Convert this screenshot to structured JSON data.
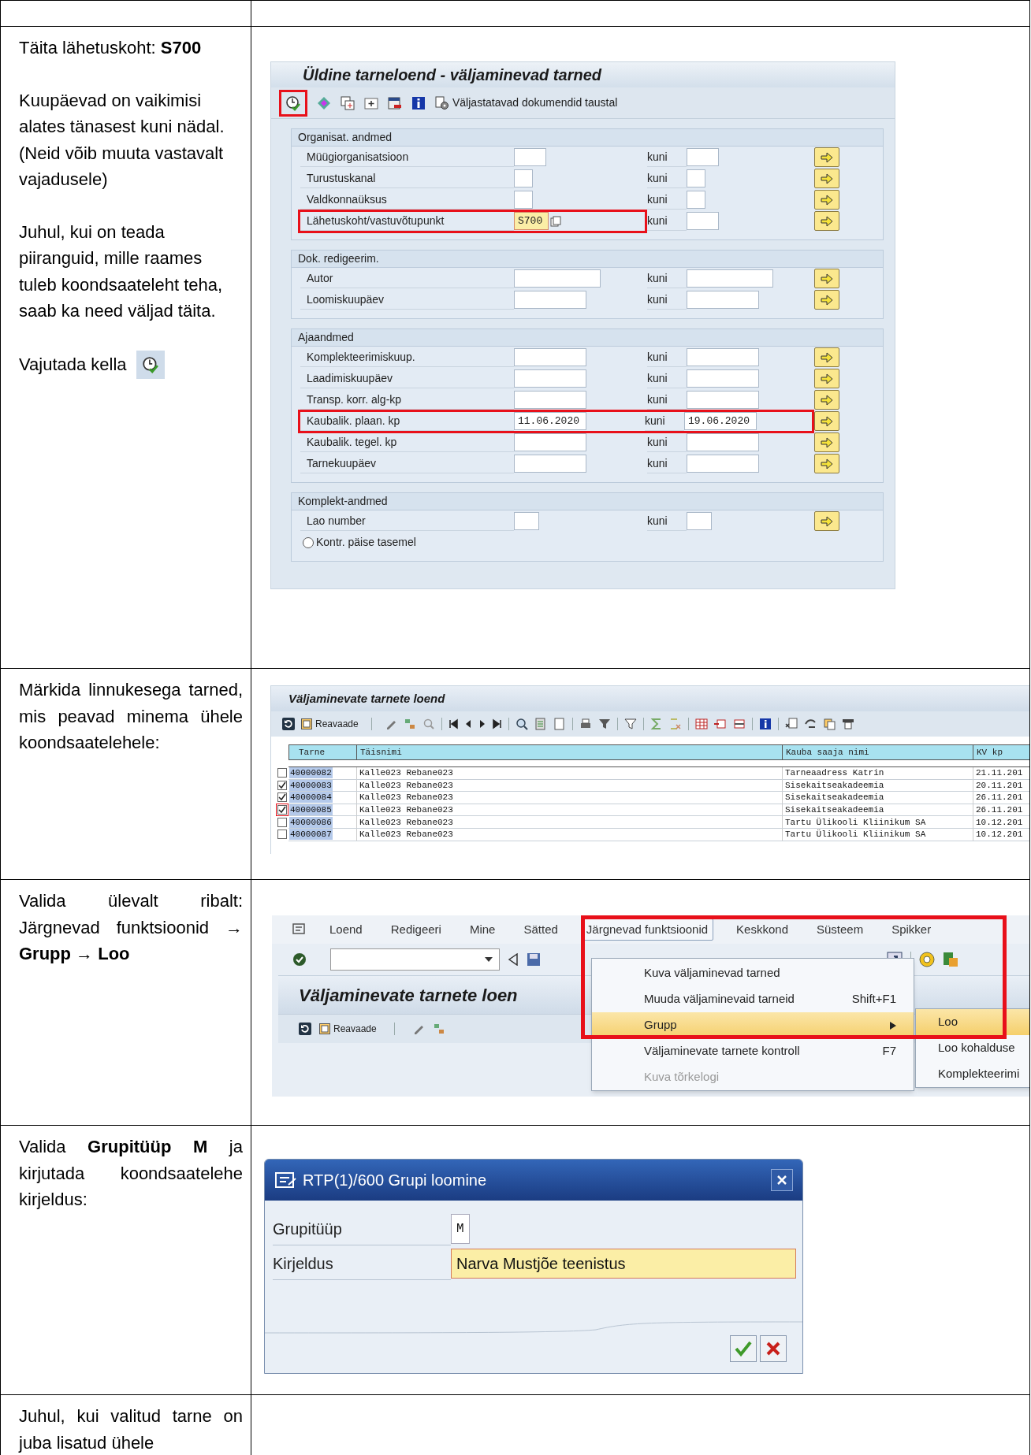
{
  "steps": [
    {
      "kind": "selection_screen",
      "paragraphs": [
        "Täita lähetuskoht: **S700**",
        "Kuupäevad on vaikimisi alates tänasest kuni nädal. (Neid võib muuta vastavalt vajadusele)",
        "Juhul, kui on teada piiranguid, mille raames tuleb koondsaateleht teha, saab ka need väljad täita.",
        "Vajutada kella"
      ],
      "screen": {
        "title": "Üldine tarneloend - väljaminevad tarned",
        "execute_highlighted": true,
        "toolbar_button": "Väljastatavad dokumendid taustal",
        "sections": [
          {
            "title": "Organisat. andmed",
            "rows": [
              {
                "label": "Müügiorganisatsioon",
                "to_label": "kuni",
                "highlighted": false,
                "focused": false
              },
              {
                "label": "Turustuskanal",
                "to_label": "kuni",
                "highlighted": false,
                "focused": false
              },
              {
                "label": "Valdkonnaüksus",
                "to_label": "kuni",
                "highlighted": false,
                "focused": false
              },
              {
                "label": "Lähetuskoht/vastuvõtupunkt",
                "from": "S700",
                "to_label": "kuni",
                "highlighted": true,
                "focused": true
              }
            ]
          },
          {
            "title": "Dok. redigeerim.",
            "rows": [
              {
                "label": "Autor",
                "to_label": "kuni",
                "highlighted": false,
                "focused": false
              },
              {
                "label": "Loomiskuupäev",
                "to_label": "kuni",
                "highlighted": false,
                "focused": false
              }
            ]
          },
          {
            "title": "Ajaandmed",
            "rows": [
              {
                "label": "Komplekteerimiskuup.",
                "to_label": "kuni",
                "highlighted": false,
                "focused": false
              },
              {
                "label": "Laadimiskuupäev",
                "to_label": "kuni",
                "highlighted": false,
                "focused": false
              },
              {
                "label": "Transp. korr. alg-kp",
                "to_label": "kuni",
                "highlighted": false,
                "focused": false
              },
              {
                "label": "Kaubalik. plaan. kp",
                "from": "11.06.2020",
                "to_label": "kuni",
                "to": "19.06.2020",
                "highlighted": true,
                "focused": false
              },
              {
                "label": "Kaubalik. tegel. kp",
                "to_label": "kuni",
                "highlighted": false,
                "focused": false
              },
              {
                "label": "Tarnekuupäev",
                "to_label": "kuni",
                "highlighted": false,
                "focused": false
              }
            ]
          },
          {
            "title": "Komplekt-andmed",
            "rows": [
              {
                "label": "Lao number",
                "to_label": "kuni",
                "highlighted": false,
                "focused": false
              }
            ],
            "options": [
              {
                "label": "Kontr. päise tasemel",
                "selected": false
              }
            ]
          }
        ]
      }
    },
    {
      "kind": "delivery_list",
      "paragraphs": [
        "Märkida linnukesega tarned, mis peavad minema ühele koondsaatelehele:"
      ],
      "screen": {
        "title": "Väljaminevate tarnete loend",
        "toolbar_button": "Reavaade",
        "columns": [
          "Tarne",
          "Täisnimi",
          "Kauba saaja nimi",
          "KV kp"
        ],
        "rows": [
          {
            "checked": false,
            "focused": false,
            "cells": [
              "40000082",
              "Kalle023 Rebane023",
              "Tarneaadress Katrin",
              "21.11.201"
            ]
          },
          {
            "checked": true,
            "focused": false,
            "cells": [
              "40000083",
              "Kalle023 Rebane023",
              "Sisekaitseakadeemia",
              "20.11.201"
            ]
          },
          {
            "checked": true,
            "focused": false,
            "cells": [
              "40000084",
              "Kalle023 Rebane023",
              "Sisekaitseakadeemia",
              "26.11.201"
            ]
          },
          {
            "checked": true,
            "focused": true,
            "cells": [
              "40000085",
              "Kalle023 Rebane023",
              "Sisekaitseakadeemia",
              "26.11.201"
            ]
          },
          {
            "checked": false,
            "focused": false,
            "cells": [
              "40000086",
              "Kalle023 Rebane023",
              "Tartu Ülikooli Kliinikum SA",
              "10.12.201"
            ]
          },
          {
            "checked": false,
            "focused": false,
            "cells": [
              "40000087",
              "Kalle023 Rebane023",
              "Tartu Ülikooli Kliinikum SA",
              "10.12.201"
            ]
          }
        ]
      }
    },
    {
      "kind": "menu",
      "paragraphs": [
        "Valida ülevalt ribalt: Järgnevad funktsioonid → **Grupp** → **Loo**"
      ],
      "screen": {
        "menu": [
          {
            "label": "Loend",
            "selected": false
          },
          {
            "label": "Redigeeri",
            "selected": false
          },
          {
            "label": "Mine",
            "selected": false
          },
          {
            "label": "Sätted",
            "selected": false
          },
          {
            "label": "Järgnevad funktsioonid",
            "selected": true
          },
          {
            "label": "Keskkond",
            "selected": false
          },
          {
            "label": "Süsteem",
            "selected": false
          },
          {
            "label": "Spikker",
            "selected": false
          }
        ],
        "dropdown": [
          {
            "label": "Kuva väljaminevad tarned",
            "selected": false,
            "disabled": false,
            "submenu": false
          },
          {
            "label": "Muuda väljaminevaid tarneid",
            "shortcut": "Shift+F1",
            "selected": false,
            "disabled": false,
            "submenu": false
          },
          {
            "label": "Grupp",
            "selected": true,
            "disabled": false,
            "submenu": true
          },
          {
            "label": "Väljaminevate tarnete kontroll",
            "shortcut": "F7",
            "selected": false,
            "disabled": false,
            "submenu": false
          },
          {
            "label": "Kuva tõrkelogi",
            "selected": false,
            "disabled": true,
            "submenu": false
          }
        ],
        "submenu": [
          {
            "label": "Loo",
            "selected": true
          },
          {
            "label": "Loo kohalduse",
            "selected": false
          },
          {
            "label": "Komplekteerimi",
            "selected": false
          }
        ],
        "background_title": "Väljaminevate tarnete loen",
        "toolbar_button": "Reavaade",
        "highlight_frame": true
      }
    },
    {
      "kind": "dialog",
      "paragraphs": [
        "Valida **Grupitüüp M** ja kirjutada koondsaatelehe kirjeldus:"
      ],
      "screen": {
        "title": "RTP(1)/600 Grupi loomine",
        "fields": [
          {
            "label": "Grupitüüp",
            "value": "M",
            "focused": false
          },
          {
            "label": "Kirjeldus",
            "value": "Narva Mustjõe teenistus",
            "focused": true
          }
        ]
      }
    },
    {
      "kind": "text",
      "paragraphs": [
        "Juhul, kui valitud tarne on juba lisatud ühele"
      ]
    }
  ]
}
